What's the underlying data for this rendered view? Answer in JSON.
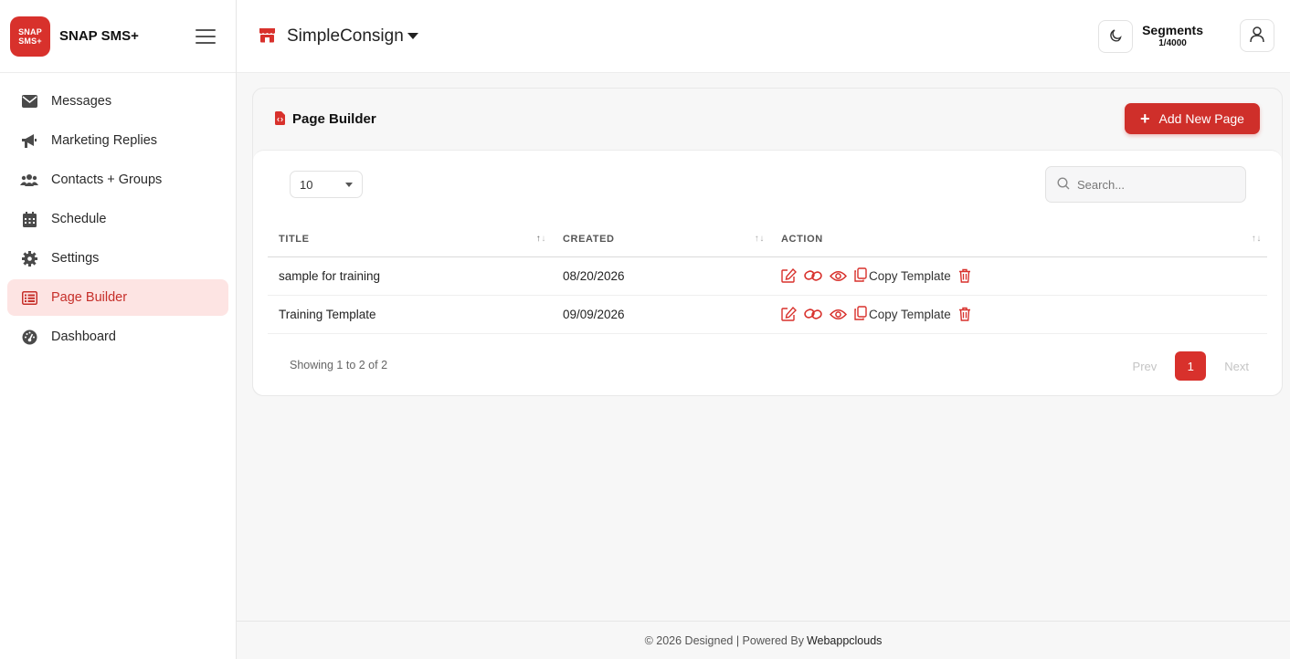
{
  "brand": {
    "logo_line1": "SNAP",
    "logo_line2": "SMS+",
    "name": "SNAP SMS+"
  },
  "sidebar": {
    "items": [
      {
        "label": "Messages",
        "icon": "envelope-icon",
        "active": false
      },
      {
        "label": "Marketing Replies",
        "icon": "megaphone-icon",
        "active": false
      },
      {
        "label": "Contacts + Groups",
        "icon": "users-icon",
        "active": false
      },
      {
        "label": "Schedule",
        "icon": "calendar-icon",
        "active": false
      },
      {
        "label": "Settings",
        "icon": "gear-icon",
        "active": false
      },
      {
        "label": "Page Builder",
        "icon": "list-icon",
        "active": true
      },
      {
        "label": "Dashboard",
        "icon": "gauge-icon",
        "active": false
      }
    ]
  },
  "header": {
    "store_name": "SimpleConsign",
    "segments_label": "Segments",
    "segments_value": "1/4000"
  },
  "page": {
    "title": "Page Builder",
    "add_button": "Add New Page",
    "page_length": "10",
    "search_placeholder": "Search..."
  },
  "table": {
    "columns": [
      "TITLE",
      "CREATED",
      "ACTION"
    ],
    "rows": [
      {
        "title": "sample for training",
        "created": "08/20/2026",
        "copy_label": "Copy Template"
      },
      {
        "title": "Training Template",
        "created": "09/09/2026",
        "copy_label": "Copy Template"
      }
    ],
    "showing": "Showing 1 to 2 of 2"
  },
  "pagination": {
    "prev": "Prev",
    "current": "1",
    "next": "Next"
  },
  "footer": {
    "text": "© 2026 Designed | Powered By",
    "link": "Webappclouds"
  },
  "colors": {
    "accent": "#cf2f2a",
    "active_bg": "#fde4e3"
  }
}
